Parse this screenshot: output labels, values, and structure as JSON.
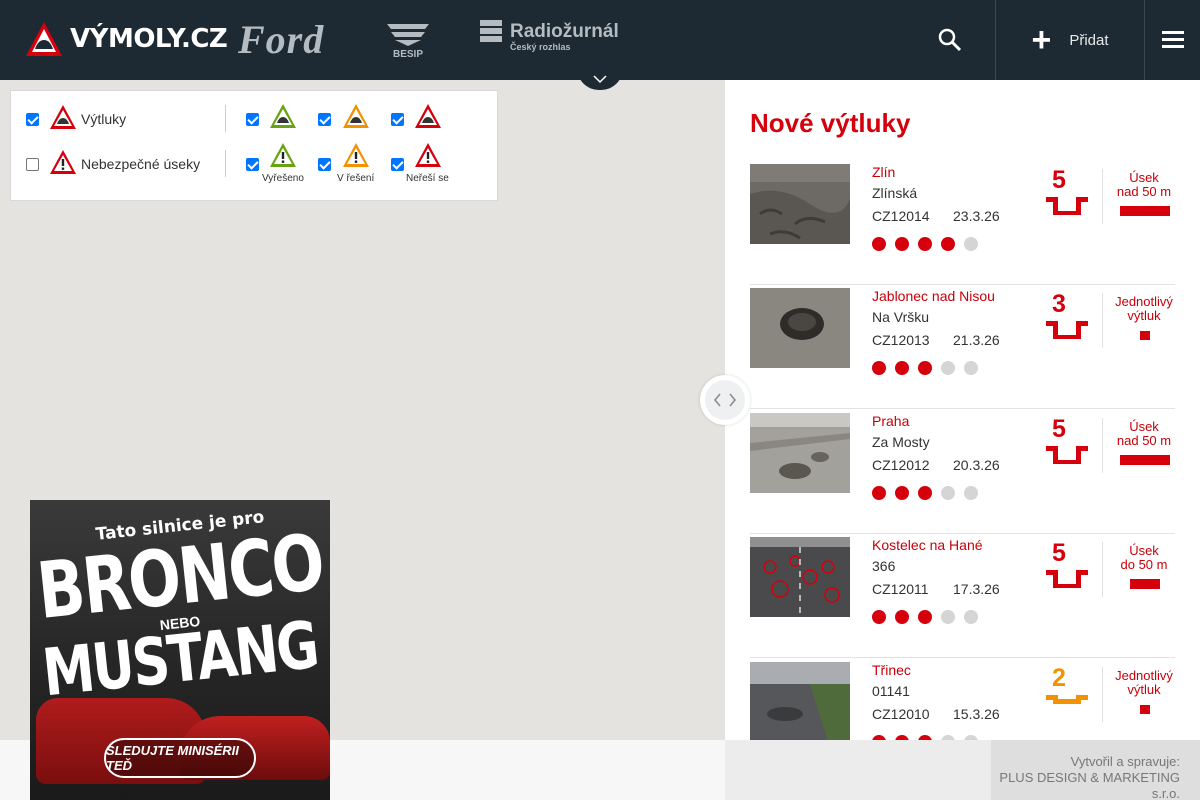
{
  "header": {
    "logo_text": "VÝMOLY.CZ",
    "partners": {
      "ford": "Ford",
      "besip": "BESIP",
      "radio_name": "Radiožurnál",
      "radio_sub": "Český rozhlas"
    },
    "add_label": "Přidat"
  },
  "filters": {
    "row1": {
      "label": "Výtluky",
      "checked": true
    },
    "row2": {
      "label": "Nebezpečné úseky",
      "checked": false
    },
    "status_labels": [
      "Vyřešeno",
      "V řešení",
      "Neřeší se"
    ],
    "colors": {
      "resolved": "#6aa312",
      "in_progress": "#f39200",
      "not_resolved": "#d5000b"
    }
  },
  "ad": {
    "tagline": "Tato silnice je pro",
    "line1": "BRONCO",
    "nebo": "NEBO",
    "line2": "MUSTANG",
    "button": "SLEDUJTE MINISÉRII TEĎ"
  },
  "list": {
    "title": "Nové výtluky",
    "items": [
      {
        "city": "Zlín",
        "street": "Zlínská",
        "code": "CZ12014",
        "date": "23.3.26",
        "severity": "5",
        "severity_color": "#d5000b",
        "dots": 4,
        "type_line1": "Úsek",
        "type_line2": "nad 50 m"
      },
      {
        "city": "Jablonec nad Nisou",
        "street": "Na Vršku",
        "code": "CZ12013",
        "date": "21.3.26",
        "severity": "3",
        "severity_color": "#d5000b",
        "dots": 3,
        "type_line1": "Jednotlivý",
        "type_line2": "výtluk"
      },
      {
        "city": "Praha",
        "street": "Za Mosty",
        "code": "CZ12012",
        "date": "20.3.26",
        "severity": "5",
        "severity_color": "#d5000b",
        "dots": 3,
        "type_line1": "Úsek",
        "type_line2": "nad 50 m"
      },
      {
        "city": "Kostelec na Hané",
        "street": "366",
        "code": "CZ12011",
        "date": "17.3.26",
        "severity": "5",
        "severity_color": "#d5000b",
        "dots": 3,
        "type_line1": "Úsek",
        "type_line2": "do 50 m"
      },
      {
        "city": "Třinec",
        "street": "01141",
        "code": "CZ12010",
        "date": "15.3.26",
        "severity": "2",
        "severity_color": "#f39200",
        "dots": 3,
        "type_line1": "Jednotlivý",
        "type_line2": "výtluk"
      }
    ]
  },
  "footer": {
    "credit_line1": "Vytvořil a spravuje:",
    "credit_line2": "PLUS DESIGN & MARKETING",
    "credit_line3": "s.r.o."
  }
}
